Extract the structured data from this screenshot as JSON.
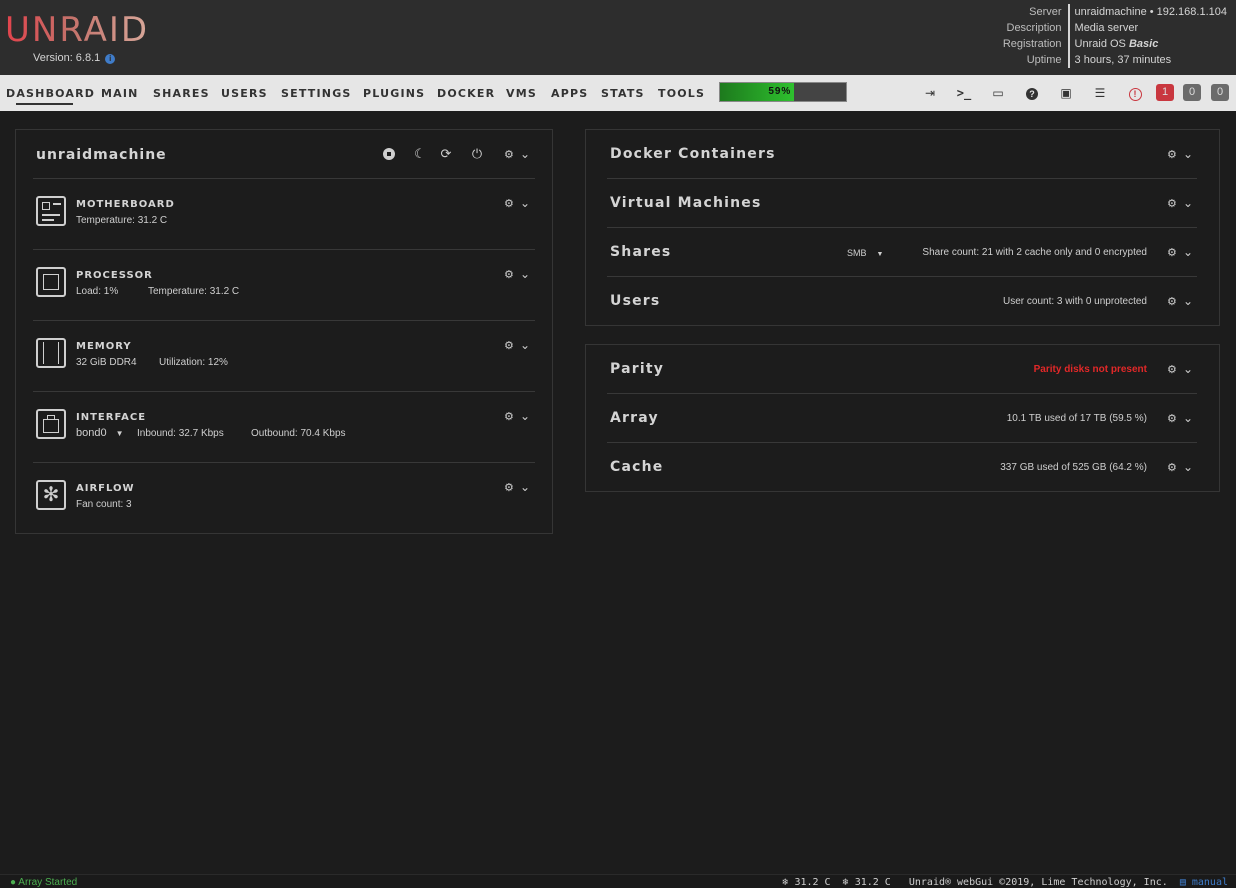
{
  "header": {
    "logo": "UNRAID",
    "version_label": "Version: 6.8.1",
    "server_info": [
      {
        "key": "Server",
        "value": "unraidmachine • 192.168.1.104"
      },
      {
        "key": "Description",
        "value": "Media server"
      },
      {
        "key": "Registration",
        "value": "Unraid OS ",
        "emph": "Basic"
      },
      {
        "key": "Uptime",
        "value": "3 hours, 37 minutes"
      }
    ]
  },
  "nav": {
    "items": [
      "DASHBOARD",
      "MAIN",
      "SHARES",
      "USERS",
      "SETTINGS",
      "PLUGINS",
      "DOCKER",
      "VMS",
      "APPS",
      "STATS",
      "TOOLS"
    ],
    "cpu_percent": 59,
    "cpu_label": "59%",
    "badges": {
      "alert": "1",
      "warning": "0",
      "notice": "0"
    }
  },
  "system": {
    "hostname": "unraidmachine",
    "motherboard": {
      "title": "MOTHERBOARD",
      "temp": "Temperature: 31.2 C"
    },
    "processor": {
      "title": "PROCESSOR",
      "load": "Load: 1%",
      "temp": "Temperature: 31.2 C"
    },
    "memory": {
      "title": "MEMORY",
      "size": "32 GiB DDR4",
      "util": "Utilization: 12%"
    },
    "interface": {
      "title": "INTERFACE",
      "port": "bond0",
      "inbound": "Inbound: 32.7 Kbps",
      "outbound": "Outbound: 70.4 Kbps"
    },
    "airflow": {
      "title": "AIRFLOW",
      "fans": "Fan count: 3"
    }
  },
  "right": {
    "docker": "Docker Containers",
    "vms": "Virtual Machines",
    "shares": {
      "title": "Shares",
      "protocol": "SMB",
      "info": "Share count: 21 with 2 cache only and 0 encrypted"
    },
    "users": {
      "title": "Users",
      "info": "User count: 3 with 0 unprotected"
    },
    "parity": {
      "title": "Parity",
      "info": "Parity disks not present"
    },
    "array": {
      "title": "Array",
      "info": "10.1 TB used of 17 TB (59.5 %)"
    },
    "cache": {
      "title": "Cache",
      "info": "337 GB used of 525 GB (64.2 %)"
    }
  },
  "footer": {
    "status": "Array Started",
    "temp1": "31.2 C",
    "temp2": "31.2 C",
    "copyright": "Unraid® webGui ©2019, Lime Technology, Inc.",
    "manual": "manual"
  },
  "colors": {
    "accent": "#e22828",
    "ok": "#4caf50",
    "link": "#3f7cc9"
  }
}
